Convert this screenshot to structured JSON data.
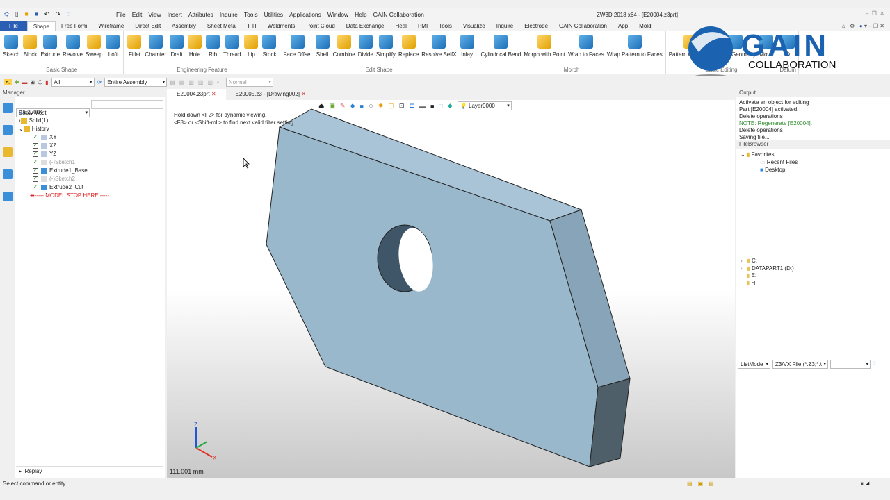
{
  "window": {
    "title": "ZW3D 2018 x64 - [E20004.z3prt]"
  },
  "menu": [
    "File",
    "Edit",
    "View",
    "Insert",
    "Attributes",
    "Inquire",
    "Tools",
    "Utilities",
    "Applications",
    "Window",
    "Help",
    "GAIN Collaboration"
  ],
  "ribbon_tabs": [
    "File",
    "Shape",
    "Free Form",
    "Wireframe",
    "Direct Edit",
    "Assembly",
    "Sheet Metal",
    "FTI",
    "Weldments",
    "Point Cloud",
    "Data Exchange",
    "Heal",
    "PMI",
    "Tools",
    "Visualize",
    "Inquire",
    "Electrode",
    "GAIN Collaboration",
    "App",
    "Mold"
  ],
  "active_tab": "Shape",
  "ribbon_groups": [
    {
      "label": "Basic Shape",
      "buttons": [
        "Sketch",
        "Block",
        "Extrude",
        "Revolve",
        "Sweep",
        "Loft"
      ]
    },
    {
      "label": "Engineering Feature",
      "buttons": [
        "Fillet",
        "Chamfer",
        "Draft",
        "Hole",
        "Rib",
        "Thread",
        "Lip",
        "Stock"
      ]
    },
    {
      "label": "Edit Shape",
      "buttons": [
        "Face Offset",
        "Shell",
        "Combine",
        "Divide",
        "Simplify",
        "Replace",
        "Resolve SelfX",
        "Inlay"
      ]
    },
    {
      "label": "Morph",
      "buttons": [
        "Cylindrical Bend",
        "Morph with Point",
        "Wrap to Faces",
        "Wrap Pattern to Faces"
      ]
    },
    {
      "label": "Basic Editing",
      "buttons": [
        "Pattern Geometry",
        "Mirror Geometry",
        "Move"
      ]
    },
    {
      "label": "Datum",
      "buttons": [
        "D"
      ]
    }
  ],
  "logo": {
    "text": "GAIN",
    "subtext": "COLLABORATION"
  },
  "toolbar": {
    "filter": "All",
    "scope": "Entire Assembly",
    "mode": "Normal"
  },
  "manager": {
    "title": "Manager",
    "filter": "Show Most",
    "tree": [
      {
        "label": "E20004",
        "type": "root"
      },
      {
        "label": "Solid(1)",
        "type": "folder"
      },
      {
        "label": "History",
        "type": "folder"
      },
      {
        "label": "XY",
        "type": "plane"
      },
      {
        "label": "XZ",
        "type": "plane"
      },
      {
        "label": "YZ",
        "type": "plane"
      },
      {
        "label": "(-)Sketch1",
        "type": "sketch"
      },
      {
        "label": "Extrude1_Base",
        "type": "feature"
      },
      {
        "label": "(-)Sketch2",
        "type": "sketch"
      },
      {
        "label": "Extrude2_Cut",
        "type": "feature"
      },
      {
        "label": "----- MODEL STOP HERE -----",
        "type": "stop"
      }
    ],
    "replay": "Replay"
  },
  "doc_tabs": [
    "E20004.z3prt",
    "E20005.z3 - [Drawing002]"
  ],
  "viewport": {
    "hint1": "Hold down <F2> for dynamic viewing.",
    "hint2": "<F8> or <Shift-roll> to find next valid filter setting.",
    "layer": "Layer0000",
    "scale": "111.001 mm",
    "part_color": "#9ab8cc"
  },
  "output": {
    "title": "Output",
    "lines": [
      "Activate an object for editing",
      "Part [E20004] activated.",
      "Delete operations",
      "NOTE: Regenerate [E20004].",
      "Delete operations",
      "Saving file..."
    ]
  },
  "filebrowser": {
    "title": "FileBrowser",
    "favorites": "Favorites",
    "fav_items": [
      "Recent Files",
      "Desktop"
    ],
    "drives": [
      "C:",
      "DATAPART1 (D:)",
      "E:",
      "H:"
    ],
    "list_mode": "ListMode",
    "file_type": "Z3/VX File (*.Z3;*.\\"
  },
  "status": {
    "text": "Select command or entity."
  }
}
